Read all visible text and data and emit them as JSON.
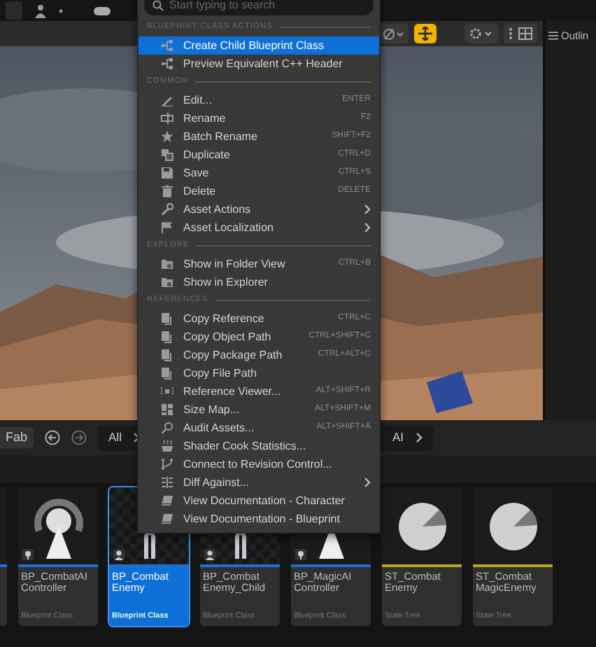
{
  "search": {
    "placeholder": "Start typing to search"
  },
  "menu": [
    {
      "heading": "BLUEPRINT CLASS ACTIONS",
      "items": [
        {
          "label": "Create Child Blueprint Class",
          "selected": true,
          "submenu": false
        },
        {
          "label": "Preview Equivalent C++ Header",
          "selected": false,
          "submenu": false
        }
      ]
    },
    {
      "heading": "COMMON",
      "items": [
        {
          "label": "Edit...",
          "shortcut": "ENTER",
          "selected": false,
          "submenu": false
        },
        {
          "label": "Rename",
          "shortcut": "F2",
          "selected": false,
          "submenu": false
        },
        {
          "label": "Batch Rename",
          "shortcut": "SHIFT+F2",
          "selected": false,
          "submenu": false
        },
        {
          "label": "Duplicate",
          "shortcut": "CTRL+D",
          "selected": false,
          "submenu": false
        },
        {
          "label": "Save",
          "shortcut": "CTRL+S",
          "selected": false,
          "submenu": false
        },
        {
          "label": "Delete",
          "shortcut": "DELETE",
          "selected": false,
          "submenu": false
        },
        {
          "label": "Asset Actions",
          "selected": false,
          "submenu": true
        },
        {
          "label": "Asset Localization",
          "selected": false,
          "submenu": true
        }
      ]
    },
    {
      "heading": "EXPLORE",
      "items": [
        {
          "label": "Show in Folder View",
          "shortcut": "CTRL+B",
          "selected": false,
          "submenu": false
        },
        {
          "label": "Show in Explorer",
          "selected": false,
          "submenu": false
        }
      ]
    },
    {
      "heading": "REFERENCES",
      "items": [
        {
          "label": "Copy Reference",
          "shortcut": "CTRL+C",
          "selected": false,
          "submenu": false
        },
        {
          "label": "Copy Object Path",
          "shortcut": "CTRL+SHIFT+C",
          "selected": false,
          "submenu": false
        },
        {
          "label": "Copy Package Path",
          "shortcut": "CTRL+ALT+C",
          "selected": false,
          "submenu": false
        },
        {
          "label": "Copy File Path",
          "selected": false,
          "submenu": false
        },
        {
          "label": "Reference Viewer...",
          "shortcut": "ALT+SHIFT+R",
          "selected": false,
          "submenu": false
        },
        {
          "label": "Size Map...",
          "shortcut": "ALT+SHIFT+M",
          "selected": false,
          "submenu": false
        },
        {
          "label": "Audit Assets...",
          "shortcut": "ALT+SHIFT+A",
          "selected": false,
          "submenu": false
        },
        {
          "label": "Shader Cook Statistics...",
          "selected": false,
          "submenu": false
        },
        {
          "label": "Connect to Revision Control...",
          "selected": false,
          "submenu": false
        },
        {
          "label": "Diff Against...",
          "selected": false,
          "submenu": true
        },
        {
          "label": "View Documentation - Character",
          "selected": false,
          "submenu": false
        },
        {
          "label": "View Documentation - Blueprint",
          "selected": false,
          "submenu": false
        }
      ]
    }
  ],
  "outliner": {
    "title": "Outlin"
  },
  "content_browser": {
    "fab_button": "Fab",
    "breadcrumbs": [
      {
        "label": "All"
      },
      {
        "label": "AI"
      }
    ],
    "assets": [
      {
        "name": "BP_CombatAI Controller",
        "type": "Blueprint Class",
        "kind": "ai-controller",
        "color": "#1e6fd0",
        "selected": false
      },
      {
        "name": "BP_Combat Enemy",
        "type": "Blueprint Class",
        "kind": "character",
        "color": "#1e6fd0",
        "selected": true
      },
      {
        "name": "BP_Combat Enemy_Child",
        "type": "Blueprint Class",
        "kind": "character",
        "color": "#1e6fd0",
        "selected": false
      },
      {
        "name": "BP_MagicAI Controller",
        "type": "Blueprint Class",
        "kind": "ai-controller",
        "color": "#1e6fd0",
        "selected": false
      },
      {
        "name": "ST_Combat Enemy",
        "type": "State Tree",
        "kind": "state-tree",
        "color": "#b5a520",
        "selected": false
      },
      {
        "name": "ST_Combat MagicEnemy",
        "type": "State Tree",
        "kind": "state-tree",
        "color": "#b5a520",
        "selected": false
      }
    ]
  }
}
